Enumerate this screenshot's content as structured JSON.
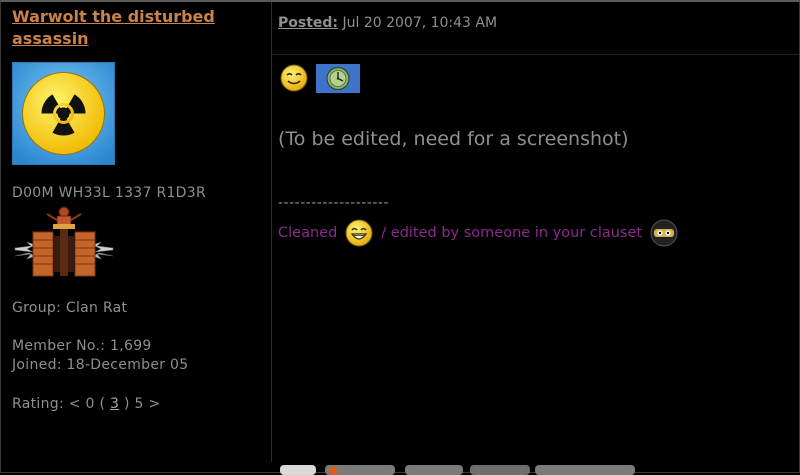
{
  "post": {
    "username": "Warwolt the disturbed assassin",
    "posted_label": "Posted:",
    "posted_date": "Jul 20 2007, 10:43 AM",
    "member_title": "D00M WH33L 1337 R1D3R",
    "group": "Group: Clan Rat",
    "member_no": "Member No.: 1,699",
    "joined": "Joined: 18-December 05",
    "rating_prefix": "Rating: < 0 (",
    "rating_value": "3",
    "rating_suffix": ") 5 >",
    "body_text": "(To be edited, need for a screenshot)",
    "divider": "--------------------",
    "edit_cleaned": "Cleaned",
    "edit_rest": "/ edited by someone in your clauset"
  },
  "icons": {
    "avatar": "radiation-icon",
    "emote1": "smile-icon",
    "emote2": "clock-icon",
    "emote3": "grin-icon",
    "emote4": "ninja-icon"
  },
  "colors": {
    "background": "#000000",
    "username": "#c8834a",
    "text": "#8f8f8f",
    "edit_note": "#8a2a8a",
    "avatar_bg": "#39a2e6",
    "radiation_yellow": "#ffd400"
  }
}
